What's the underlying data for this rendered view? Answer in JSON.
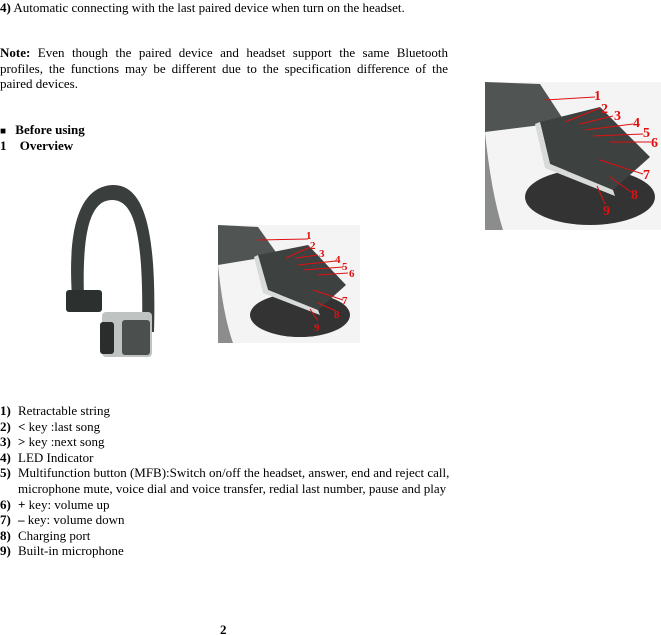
{
  "intro": {
    "item4_num": "4)",
    "item4_text": "Automatic connecting with the last paired device when turn on the headset.",
    "note_label": "Note:",
    "note_text": "Even though the paired device and headset support the same Bluetooth profiles, the functions may be different due to the specification difference of the paired devices."
  },
  "section": {
    "bullet": "■",
    "heading": "Before using",
    "sub_num": "1",
    "sub_heading": "Overview"
  },
  "callouts": [
    "1",
    "2",
    "3",
    "4",
    "5",
    "6",
    "7",
    "8",
    "9"
  ],
  "callout_color": "#e01010",
  "parts": [
    {
      "num": "1)",
      "text": "Retractable string"
    },
    {
      "num": "2)",
      "key": "<",
      "text": "key :last song"
    },
    {
      "num": "3)",
      "key": ">",
      "text": "key :next song"
    },
    {
      "num": "4)",
      "text": "LED Indicator"
    },
    {
      "num": "5)",
      "text": "Multifunction button (MFB):Switch on/off the headset, answer, end and reject call, microphone mute, voice dial and voice transfer, redial last number, pause and play"
    },
    {
      "num": "6)",
      "key": "+",
      "text": "key: volume up"
    },
    {
      "num": "7)",
      "key": "–",
      "text": "key: volume down"
    },
    {
      "num": "8)",
      "text": "Charging port"
    },
    {
      "num": "9)",
      "text": "Built-in microphone"
    }
  ],
  "page_number": "2"
}
